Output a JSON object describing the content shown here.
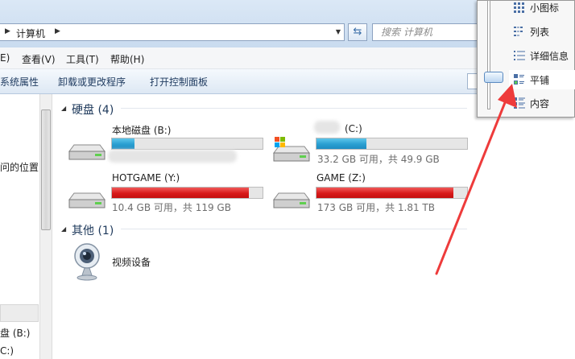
{
  "address": {
    "path": [
      "计算机"
    ],
    "search_placeholder": "搜索 计算机"
  },
  "menu": [
    "E)",
    "查看(V)",
    "工具(T)",
    "帮助(H)"
  ],
  "toolbar": [
    "系统属性",
    "卸载或更改程序",
    "打开控制面板"
  ],
  "nav": {
    "item_location": "问的位置",
    "item_drive_b": "盘 (B:)",
    "item_drive_c": "C:)"
  },
  "groups": {
    "hard_disks": {
      "label": "硬盘 (4)"
    },
    "other": {
      "label": "其他 (1)"
    }
  },
  "drives": [
    {
      "name": "本地磁盘 (B:)",
      "info": "",
      "used_fraction": 0.15,
      "color": "#2a9fd1"
    },
    {
      "name": "(C:)",
      "info": "33.2 GB 可用，共 49.9 GB",
      "used_fraction": 0.33,
      "color": "#2a9fd1"
    },
    {
      "name": "HOTGAME (Y:)",
      "info": "10.4 GB 可用，共 119 GB",
      "used_fraction": 0.91,
      "color": "#d81a1a"
    },
    {
      "name": "GAME (Z:)",
      "info": "173 GB 可用，共 1.81 TB",
      "used_fraction": 0.91,
      "color": "#d81a1a"
    }
  ],
  "other_devices": [
    {
      "name": "视频设备"
    }
  ],
  "view_menu": {
    "items": [
      "小图标",
      "列表",
      "详细信息",
      "平铺",
      "内容"
    ],
    "selected": "平铺"
  },
  "annotation": {
    "color": "#ee3b3b"
  }
}
